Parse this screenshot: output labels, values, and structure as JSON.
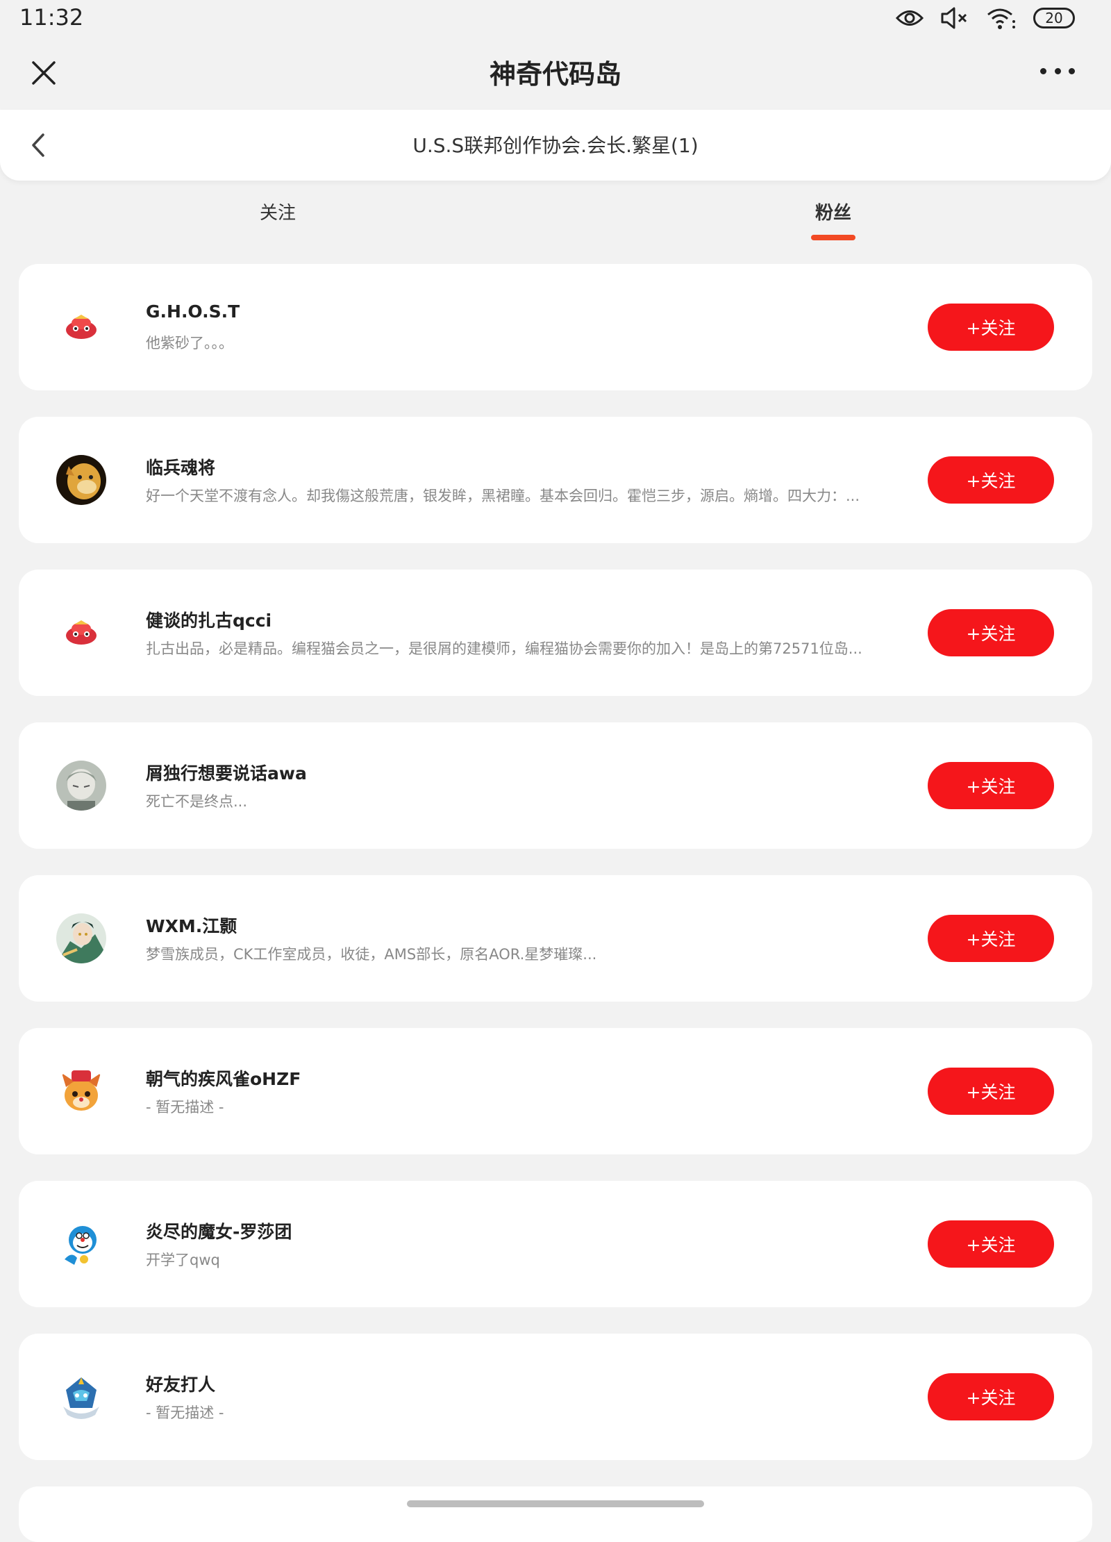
{
  "status_bar": {
    "time": "11:32",
    "battery": "20",
    "icons": [
      "eye-icon",
      "mute-icon",
      "wifi-icon",
      "battery-icon"
    ]
  },
  "title_bar": {
    "title": "神奇代码岛",
    "close_icon": "close-icon",
    "more_icon": "more-icon"
  },
  "sub_header": {
    "title": "U.S.S联邦创作协会.会长.繁星(1)",
    "back_icon": "chevron-left-icon"
  },
  "tabs": [
    {
      "label": "关注",
      "active": false
    },
    {
      "label": "粉丝",
      "active": true
    }
  ],
  "colors": {
    "accent": "#f5161b",
    "tab_underline": "#f24a24",
    "background": "#f2f2f2"
  },
  "fans": [
    {
      "name": "G.H.O.S.T",
      "desc": "他紫砂了。。。",
      "button": "+关注",
      "avatar": "red-lion-mascot"
    },
    {
      "name": "临兵魂将",
      "desc": "好一个天堂不渡有念人。却我傷这般荒唐，银发眸，黑裙瞳。基本会回归。霍恺三步，源启。熵增。四大力：...",
      "button": "+关注",
      "avatar": "shiba-dog"
    },
    {
      "name": "健谈的扎古qcci",
      "desc": "扎古出品，必是精品。编程猫会员之一，是很屑的建模师，编程猫协会需要你的加入！是岛上的第72571位岛...",
      "button": "+关注",
      "avatar": "red-lion-mascot"
    },
    {
      "name": "屑独行想要说话awa",
      "desc": "死亡不是终点...",
      "button": "+关注",
      "avatar": "anime-gray"
    },
    {
      "name": "WXM.江颢",
      "desc": "梦雪族成员，CK工作室成员，收徒，AMS部长，原名AOR.星梦璀璨...",
      "button": "+关注",
      "avatar": "anime-green"
    },
    {
      "name": "朝气的疾风雀oHZF",
      "desc": "- 暂无描述 -",
      "button": "+关注",
      "avatar": "cartoon-deer"
    },
    {
      "name": "炎尽的魔女-罗莎团",
      "desc": "开学了qwq",
      "button": "+关注",
      "avatar": "blue-robot-cat"
    },
    {
      "name": "好友打人",
      "desc": "- 暂无描述 -",
      "button": "+关注",
      "avatar": "blue-creature"
    }
  ]
}
